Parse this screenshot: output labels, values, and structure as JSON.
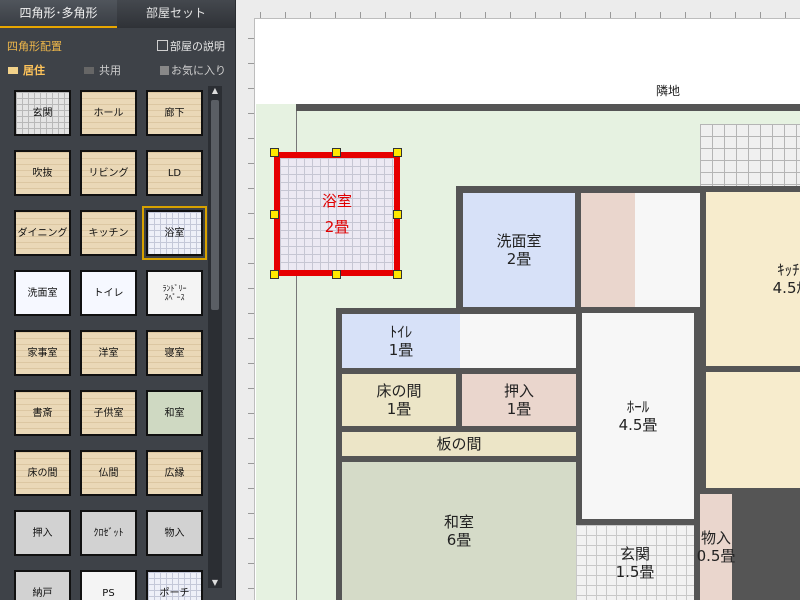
{
  "tabs": [
    "四角形･多角形",
    "部屋セット"
  ],
  "section_title": "四角形配置",
  "room_description_label": "部屋の説明",
  "categories": [
    "居住",
    "共用",
    "お気に入り"
  ],
  "palette": [
    "玄関",
    "ホール",
    "廊下",
    "吹抜",
    "リビング",
    "LD",
    "ダイニング",
    "キッチン",
    "浴室",
    "洗面室",
    "トイレ",
    "ﾗﾝﾄﾞﾘｰ\nｽﾍﾟｰｽ",
    "家事室",
    "洋室",
    "寝室",
    "書斎",
    "子供室",
    "和室",
    "床の間",
    "仏間",
    "広縁",
    "押入",
    "ｸﾛｾﾞｯﾄ",
    "物入",
    "納戸",
    "PS",
    "ポーチ"
  ],
  "palette_selected": "浴室",
  "canvas": {
    "neighbor_label": "隣地",
    "selected_room": "浴室\n2畳",
    "rooms": {
      "wash": "洗面室\n2畳",
      "toilet": "ﾄｲﾚ\n1畳",
      "tokonoma": "床の間\n1畳",
      "oshiire": "押入\n1畳",
      "hall": "ﾎｰﾙ\n4.5畳",
      "itanoma": "板の間",
      "washitsu": "和室\n6畳",
      "genkan": "玄関\n1.5畳",
      "monoire": "物入\n0.5畳",
      "kitchen": "ｷｯﾁ\n4.5ｶ"
    }
  },
  "colors": {
    "accent": "#e8a600",
    "selection": "#e60000",
    "handle": "#ffe800"
  }
}
